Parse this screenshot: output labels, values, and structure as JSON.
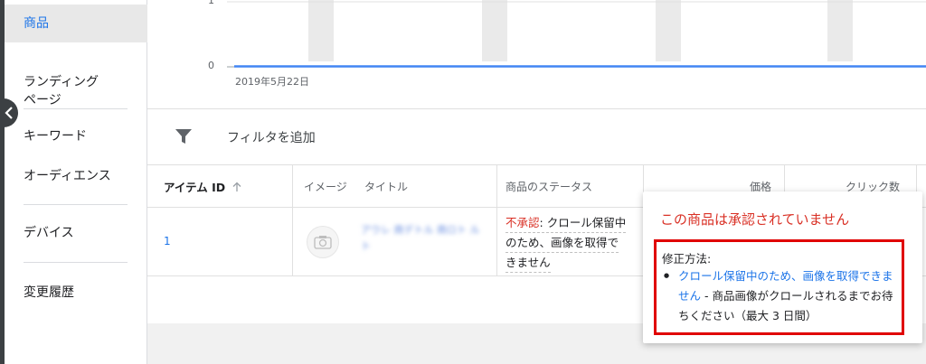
{
  "sidebar": {
    "items": [
      {
        "label": "商品"
      },
      {
        "label": "ランディング\nページ"
      },
      {
        "label": "キーワード"
      },
      {
        "label": "オーディエンス"
      },
      {
        "label": "デバイス"
      },
      {
        "label": "変更履歴"
      }
    ]
  },
  "chart": {
    "y_top_label": "1",
    "y_zero_label": "0",
    "date_label": "2019年5月22日"
  },
  "filter": {
    "label": "フィルタを追加"
  },
  "table": {
    "headers": {
      "item_id": "アイテム ID",
      "image": "イメージ",
      "title": "タイトル",
      "status": "商品のステータス",
      "price": "価格",
      "clicks": "クリック数"
    },
    "row": {
      "item_id": "1",
      "title_blurred": "アウレ 商デトル 商ロト ルト",
      "status_prefix": "不承認",
      "status_line1_rest": ": クロール保留中",
      "status_line2": "のため、画像を取得で",
      "status_line3": "きません"
    }
  },
  "popup": {
    "title": "この商品は承認されていません",
    "fix_heading": "修正方法:",
    "fix_link": "クロール保留中のため、画像を取得できません",
    "fix_rest": " - 商品画像がクロールされるまでお待ちください（最大 3 日間）"
  },
  "icons": [
    "chevron-left-icon",
    "filter-icon",
    "sort-arrow-up-icon",
    "camera-icon"
  ],
  "colors": {
    "accent": "#1a73e8",
    "error": "#d93025",
    "highlight_box": "#e00000"
  }
}
